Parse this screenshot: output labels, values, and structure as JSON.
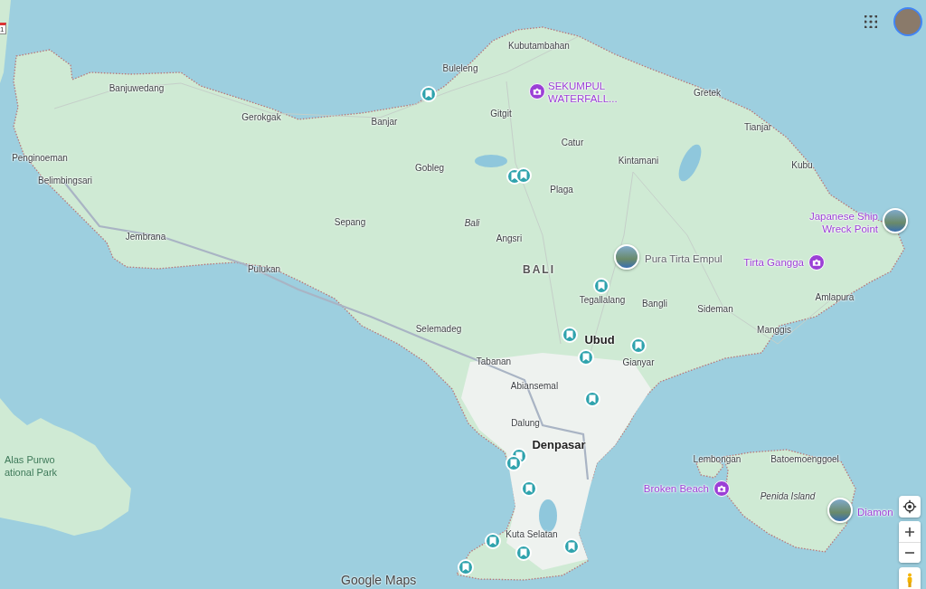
{
  "map": {
    "route_shield": "1",
    "places": [
      {
        "name": "Banjuwedang",
        "kind": "town"
      },
      {
        "name": "Gerokgak",
        "kind": "town"
      },
      {
        "name": "Banjar",
        "kind": "town"
      },
      {
        "name": "Buleleng",
        "kind": "town"
      },
      {
        "name": "Kubutambahan",
        "kind": "town"
      },
      {
        "name": "Gretek",
        "kind": "town"
      },
      {
        "name": "Tianjar",
        "kind": "town"
      },
      {
        "name": "Kubu",
        "kind": "town"
      },
      {
        "name": "Gitgit",
        "kind": "town"
      },
      {
        "name": "Catur",
        "kind": "town"
      },
      {
        "name": "Kintamani",
        "kind": "town"
      },
      {
        "name": "Penginoeman",
        "kind": "town"
      },
      {
        "name": "Belimbingsari",
        "kind": "town"
      },
      {
        "name": "Gobleg",
        "kind": "town"
      },
      {
        "name": "Plaga",
        "kind": "town"
      },
      {
        "name": "Sepang",
        "kind": "town"
      },
      {
        "name": "Bali",
        "kind": "area"
      },
      {
        "name": "Angsri",
        "kind": "town"
      },
      {
        "name": "Jembrana",
        "kind": "town"
      },
      {
        "name": "Pulukan",
        "kind": "town"
      },
      {
        "name": "BALI",
        "kind": "region"
      },
      {
        "name": "Tegallalang",
        "kind": "town"
      },
      {
        "name": "Bangli",
        "kind": "town"
      },
      {
        "name": "Sideman",
        "kind": "town"
      },
      {
        "name": "Amlapura",
        "kind": "town"
      },
      {
        "name": "Manggis",
        "kind": "town"
      },
      {
        "name": "Selemadeg",
        "kind": "town"
      },
      {
        "name": "Ubud",
        "kind": "city"
      },
      {
        "name": "Tabanan",
        "kind": "town"
      },
      {
        "name": "Gianyar",
        "kind": "town"
      },
      {
        "name": "Abiansemal",
        "kind": "town"
      },
      {
        "name": "Dalung",
        "kind": "town"
      },
      {
        "name": "Denpasar",
        "kind": "city"
      },
      {
        "name": "Lembongan",
        "kind": "town"
      },
      {
        "name": "Batoemoenggoel",
        "kind": "town"
      },
      {
        "name": "Penida Island",
        "kind": "area"
      },
      {
        "name": "Kuta Selatan",
        "kind": "town"
      },
      {
        "lines": [
          "Alas Purwo",
          "ational Park"
        ],
        "kind": "park"
      }
    ],
    "pois": [
      {
        "lines": [
          "SEKUMPUL",
          "WATERFALL..."
        ],
        "kind": "camera",
        "color": "#9b3fd6"
      },
      {
        "lines": [
          "Japanese Ship",
          "Wreck Point"
        ],
        "kind": "photo",
        "color": "#9b3fd6"
      },
      {
        "lines": [
          "Pura Tirta Empul"
        ],
        "kind": "photo",
        "color": "#5f6368"
      },
      {
        "lines": [
          "Tirta Gangga"
        ],
        "kind": "camera",
        "color": "#9b3fd6"
      },
      {
        "lines": [
          "Broken Beach"
        ],
        "kind": "camera",
        "color": "#9b3fd6"
      },
      {
        "lines": [
          "Diamon"
        ],
        "kind": "photo",
        "color": "#9b3fd6"
      }
    ],
    "attribution": "Google Maps"
  }
}
